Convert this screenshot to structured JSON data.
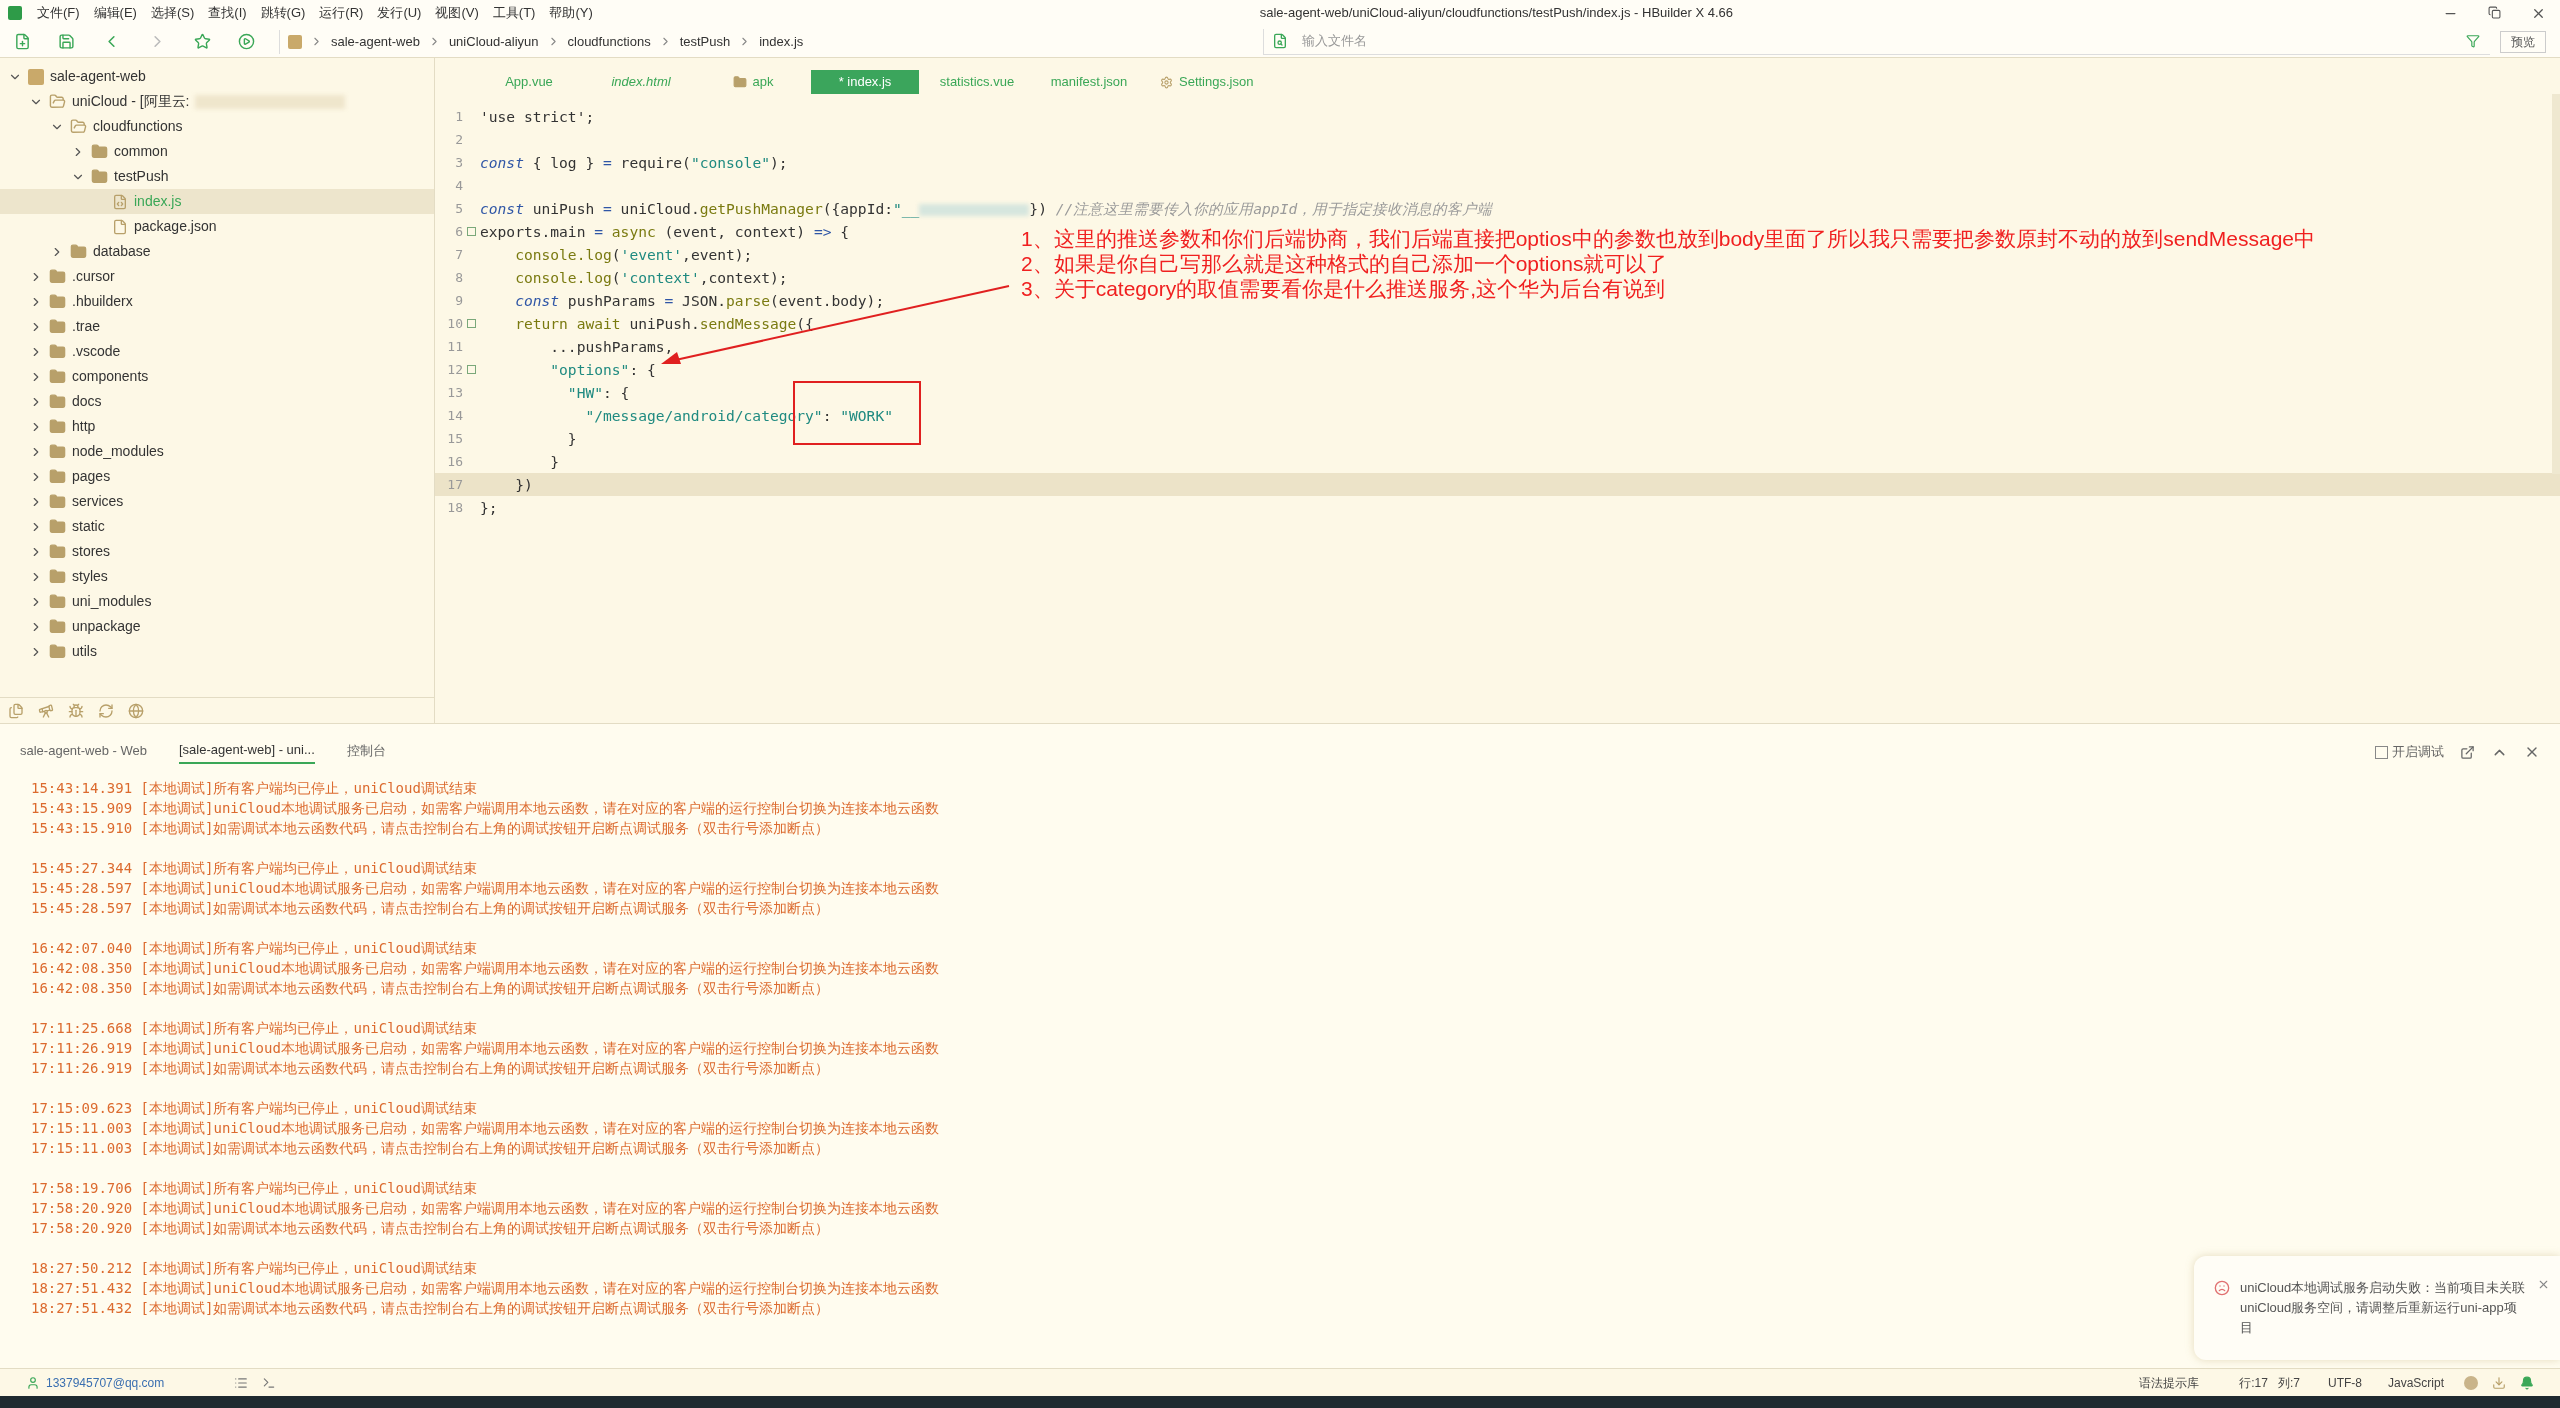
{
  "window": {
    "title": "sale-agent-web/uniCloud-aliyun/cloudfunctions/testPush/index.js - HBuilder X 4.66"
  },
  "menu": [
    "文件(F)",
    "编辑(E)",
    "选择(S)",
    "查找(I)",
    "跳转(G)",
    "运行(R)",
    "发行(U)",
    "视图(V)",
    "工具(T)",
    "帮助(Y)"
  ],
  "breadcrumb": [
    "sale-agent-web",
    "uniCloud-aliyun",
    "cloudfunctions",
    "testPush",
    "index.js"
  ],
  "file_search": {
    "placeholder": "输入文件名"
  },
  "preview_button": "预览",
  "tree": [
    {
      "label": "sale-agent-web",
      "kind": "project",
      "expanded": true,
      "selected": false,
      "children": [
        {
          "label": "uniCloud - [阿里云:",
          "kind": "folder-open",
          "expanded": true,
          "selected": false,
          "redacted": true,
          "children": [
            {
              "label": "cloudfunctions",
              "kind": "folder-open",
              "expanded": true,
              "selected": false,
              "children": [
                {
                  "label": "common",
                  "kind": "folder",
                  "expanded": false,
                  "selected": false
                },
                {
                  "label": "testPush",
                  "kind": "folder",
                  "expanded": true,
                  "selected": false,
                  "children": [
                    {
                      "label": "index.js",
                      "kind": "file-js",
                      "selected": true
                    },
                    {
                      "label": "package.json",
                      "kind": "file-json",
                      "selected": false
                    }
                  ]
                }
              ]
            },
            {
              "label": "database",
              "kind": "folder",
              "expanded": false,
              "selected": false
            }
          ]
        },
        {
          "label": ".cursor",
          "kind": "folder",
          "expanded": false,
          "selected": false
        },
        {
          "label": ".hbuilderx",
          "kind": "folder",
          "expanded": false,
          "selected": false
        },
        {
          "label": ".trae",
          "kind": "folder",
          "expanded": false,
          "selected": false
        },
        {
          "label": ".vscode",
          "kind": "folder",
          "expanded": false,
          "selected": false
        },
        {
          "label": "components",
          "kind": "folder",
          "expanded": false,
          "selected": false
        },
        {
          "label": "docs",
          "kind": "folder",
          "expanded": false,
          "selected": false
        },
        {
          "label": "http",
          "kind": "folder",
          "expanded": false,
          "selected": false
        },
        {
          "label": "node_modules",
          "kind": "folder",
          "expanded": false,
          "selected": false
        },
        {
          "label": "pages",
          "kind": "folder",
          "expanded": false,
          "selected": false
        },
        {
          "label": "services",
          "kind": "folder",
          "expanded": false,
          "selected": false
        },
        {
          "label": "static",
          "kind": "folder",
          "expanded": false,
          "selected": false
        },
        {
          "label": "stores",
          "kind": "folder",
          "expanded": false,
          "selected": false
        },
        {
          "label": "styles",
          "kind": "folder",
          "expanded": false,
          "selected": false
        },
        {
          "label": "uni_modules",
          "kind": "folder",
          "expanded": false,
          "selected": false
        },
        {
          "label": "unpackage",
          "kind": "folder",
          "expanded": false,
          "selected": false
        },
        {
          "label": "utils",
          "kind": "folder",
          "expanded": false,
          "selected": false
        }
      ]
    }
  ],
  "editor_tabs": [
    {
      "label": "App.vue",
      "kind": "file",
      "preview": false,
      "selected": false
    },
    {
      "label": "index.html",
      "kind": "file",
      "preview": true,
      "selected": false
    },
    {
      "label": "apk",
      "kind": "folder",
      "preview": false,
      "selected": false
    },
    {
      "label": "* index.js",
      "kind": "file",
      "preview": false,
      "selected": true
    },
    {
      "label": "statistics.vue",
      "kind": "file",
      "preview": false,
      "selected": false
    },
    {
      "label": "manifest.json",
      "kind": "file",
      "preview": false,
      "selected": false
    },
    {
      "label": "Settings.json",
      "kind": "settings",
      "preview": false,
      "selected": false
    }
  ],
  "code": [
    {
      "number": "1",
      "fold": false,
      "current": false,
      "tokens": [
        {
          "kind": "plain",
          "text": "'use strict';"
        }
      ]
    },
    {
      "number": "2",
      "fold": false,
      "current": false
    },
    {
      "number": "3",
      "fold": false,
      "current": false,
      "tokens": [
        {
          "kind": "keyword",
          "text": "const"
        },
        {
          "kind": "plain",
          "text": " { log } "
        },
        {
          "kind": "operator",
          "text": "="
        },
        {
          "kind": "plain",
          "text": " require"
        },
        {
          "kind": "plain",
          "text": "("
        },
        {
          "kind": "string",
          "text": "\"console\""
        },
        {
          "kind": "plain",
          "text": ");"
        }
      ]
    },
    {
      "number": "4",
      "fold": false,
      "current": false
    },
    {
      "number": "5",
      "fold": false,
      "current": false,
      "tokens": [
        {
          "kind": "keyword",
          "text": "const"
        },
        {
          "kind": "plain",
          "text": " uniPush "
        },
        {
          "kind": "operator",
          "text": "="
        },
        {
          "kind": "plain",
          "text": " uniCloud."
        },
        {
          "kind": "func",
          "text": "getPushManager"
        },
        {
          "kind": "plain",
          "text": "({appId:"
        },
        {
          "kind": "string",
          "text": "\"__"
        },
        {
          "kind": "redacted"
        },
        {
          "kind": "plain",
          "text": "}) "
        },
        {
          "kind": "comment",
          "text": "//注意这里需要传入你的应用appId，用于指定接收消息的客户端"
        }
      ]
    },
    {
      "number": "6",
      "fold": true,
      "current": false,
      "tokens": [
        {
          "kind": "plain",
          "text": "exports.main "
        },
        {
          "kind": "operator",
          "text": "="
        },
        {
          "kind": "func",
          "text": " async"
        },
        {
          "kind": "plain",
          "text": " (event, context) "
        },
        {
          "kind": "keyword",
          "text": "=>"
        },
        {
          "kind": "plain",
          "text": " {"
        }
      ]
    },
    {
      "number": "7",
      "fold": false,
      "current": false,
      "tokens": [
        {
          "kind": "func",
          "text": "    console.log"
        },
        {
          "kind": "plain",
          "text": "("
        },
        {
          "kind": "string",
          "text": "'event'"
        },
        {
          "kind": "plain",
          "text": ",event);"
        }
      ]
    },
    {
      "number": "8",
      "fold": false,
      "current": false,
      "tokens": [
        {
          "kind": "func",
          "text": "    console.log"
        },
        {
          "kind": "plain",
          "text": "("
        },
        {
          "kind": "string",
          "text": "'context'"
        },
        {
          "kind": "plain",
          "text": ",context);"
        }
      ]
    },
    {
      "number": "9",
      "fold": false,
      "current": false,
      "tokens": [
        {
          "kind": "keyword",
          "text": "    const"
        },
        {
          "kind": "plain",
          "text": " pushParams "
        },
        {
          "kind": "operator",
          "text": "="
        },
        {
          "kind": "plain",
          "text": " JSON."
        },
        {
          "kind": "func",
          "text": "parse"
        },
        {
          "kind": "plain",
          "text": "(event.body);"
        }
      ]
    },
    {
      "number": "10",
      "fold": true,
      "current": false,
      "tokens": [
        {
          "kind": "func",
          "text": "    return await"
        },
        {
          "kind": "plain",
          "text": " uniPush."
        },
        {
          "kind": "func",
          "text": "sendMessage"
        },
        {
          "kind": "plain",
          "text": "({"
        }
      ]
    },
    {
      "number": "11",
      "fold": false,
      "current": false,
      "tokens": [
        {
          "kind": "plain",
          "text": "        ...pushParams,"
        }
      ]
    },
    {
      "number": "12",
      "fold": true,
      "current": false,
      "tokens": [
        {
          "kind": "string",
          "text": "        \"options\""
        },
        {
          "kind": "plain",
          "text": ": {"
        }
      ]
    },
    {
      "number": "13",
      "fold": false,
      "current": false,
      "tokens": [
        {
          "kind": "string",
          "text": "          \"HW\""
        },
        {
          "kind": "plain",
          "text": ": {"
        }
      ]
    },
    {
      "number": "14",
      "fold": false,
      "current": false,
      "tokens": [
        {
          "kind": "string",
          "text": "            \"/message/android/category\""
        },
        {
          "kind": "plain",
          "text": ": "
        },
        {
          "kind": "string",
          "text": "\"WORK\""
        }
      ]
    },
    {
      "number": "15",
      "fold": false,
      "current": false,
      "tokens": [
        {
          "kind": "plain",
          "text": "          }"
        }
      ]
    },
    {
      "number": "16",
      "fold": false,
      "current": false,
      "tokens": [
        {
          "kind": "plain",
          "text": "        }"
        }
      ]
    },
    {
      "number": "17",
      "fold": false,
      "current": true,
      "tokens": [
        {
          "kind": "plain",
          "text": "    })"
        }
      ]
    },
    {
      "number": "18",
      "fold": false,
      "current": false,
      "tokens": [
        {
          "kind": "plain",
          "text": "};"
        }
      ]
    }
  ],
  "annotations": [
    "1、这里的推送参数和你们后端协商，我们后端直接把optios中的参数也放到body里面了所以我只需要把参数原封不动的放到sendMessage中",
    "2、如果是你自己写那么就是这种格式的自己添加一个options就可以了",
    "3、关于category的取值需要看你是什么推送服务,这个华为后台有说到"
  ],
  "console": {
    "tabs": [
      {
        "label": "sale-agent-web - Web",
        "selected": false
      },
      {
        "label": "[sale-agent-web] - uni...",
        "selected": true
      },
      {
        "label": "控制台",
        "selected": false
      }
    ],
    "debug": {
      "label": "开启调试",
      "checked": false
    },
    "groups": [
      [
        {
          "time": "15:43:14.391",
          "text": "[本地调试]所有客户端均已停止，uniCloud调试结束"
        },
        {
          "time": "15:43:15.909",
          "text": "[本地调试]uniCloud本地调试服务已启动，如需客户端调用本地云函数，请在对应的客户端的运行控制台切换为连接本地云函数"
        },
        {
          "time": "15:43:15.910",
          "text": "[本地调试]如需调试本地云函数代码，请点击控制台右上角的调试按钮开启断点调试服务（双击行号添加断点）"
        }
      ],
      [
        {
          "time": "15:45:27.344",
          "text": "[本地调试]所有客户端均已停止，uniCloud调试结束"
        },
        {
          "time": "15:45:28.597",
          "text": "[本地调试]uniCloud本地调试服务已启动，如需客户端调用本地云函数，请在对应的客户端的运行控制台切换为连接本地云函数"
        },
        {
          "time": "15:45:28.597",
          "text": "[本地调试]如需调试本地云函数代码，请点击控制台右上角的调试按钮开启断点调试服务（双击行号添加断点）"
        }
      ],
      [
        {
          "time": "16:42:07.040",
          "text": "[本地调试]所有客户端均已停止，uniCloud调试结束"
        },
        {
          "time": "16:42:08.350",
          "text": "[本地调试]uniCloud本地调试服务已启动，如需客户端调用本地云函数，请在对应的客户端的运行控制台切换为连接本地云函数"
        },
        {
          "time": "16:42:08.350",
          "text": "[本地调试]如需调试本地云函数代码，请点击控制台右上角的调试按钮开启断点调试服务（双击行号添加断点）"
        }
      ],
      [
        {
          "time": "17:11:25.668",
          "text": "[本地调试]所有客户端均已停止，uniCloud调试结束"
        },
        {
          "time": "17:11:26.919",
          "text": "[本地调试]uniCloud本地调试服务已启动，如需客户端调用本地云函数，请在对应的客户端的运行控制台切换为连接本地云函数"
        },
        {
          "time": "17:11:26.919",
          "text": "[本地调试]如需调试本地云函数代码，请点击控制台右上角的调试按钮开启断点调试服务（双击行号添加断点）"
        }
      ],
      [
        {
          "time": "17:15:09.623",
          "text": "[本地调试]所有客户端均已停止，uniCloud调试结束"
        },
        {
          "time": "17:15:11.003",
          "text": "[本地调试]uniCloud本地调试服务已启动，如需客户端调用本地云函数，请在对应的客户端的运行控制台切换为连接本地云函数"
        },
        {
          "time": "17:15:11.003",
          "text": "[本地调试]如需调试本地云函数代码，请点击控制台右上角的调试按钮开启断点调试服务（双击行号添加断点）"
        }
      ],
      [
        {
          "time": "17:58:19.706",
          "text": "[本地调试]所有客户端均已停止，uniCloud调试结束"
        },
        {
          "time": "17:58:20.920",
          "text": "[本地调试]uniCloud本地调试服务已启动，如需客户端调用本地云函数，请在对应的客户端的运行控制台切换为连接本地云函数"
        },
        {
          "time": "17:58:20.920",
          "text": "[本地调试]如需调试本地云函数代码，请点击控制台右上角的调试按钮开启断点调试服务（双击行号添加断点）"
        }
      ],
      [
        {
          "time": "18:27:50.212",
          "text": "[本地调试]所有客户端均已停止，uniCloud调试结束"
        },
        {
          "time": "18:27:51.432",
          "text": "[本地调试]uniCloud本地调试服务已启动，如需客户端调用本地云函数，请在对应的客户端的运行控制台切换为连接本地云函数"
        },
        {
          "time": "18:27:51.432",
          "text": "[本地调试]如需调试本地云函数代码，请点击控制台右上角的调试按钮开启断点调试服务（双击行号添加断点）"
        }
      ]
    ]
  },
  "notification": {
    "text": "uniCloud本地调试服务启动失败：当前项目未关联uniCloud服务空间，请调整后重新运行uni-app项目"
  },
  "status_bar": {
    "account": "1337945707@qq.com",
    "syntax": "语法提示库",
    "line": "行:17",
    "column": "列:7",
    "encoding": "UTF-8",
    "language": "JavaScript"
  }
}
